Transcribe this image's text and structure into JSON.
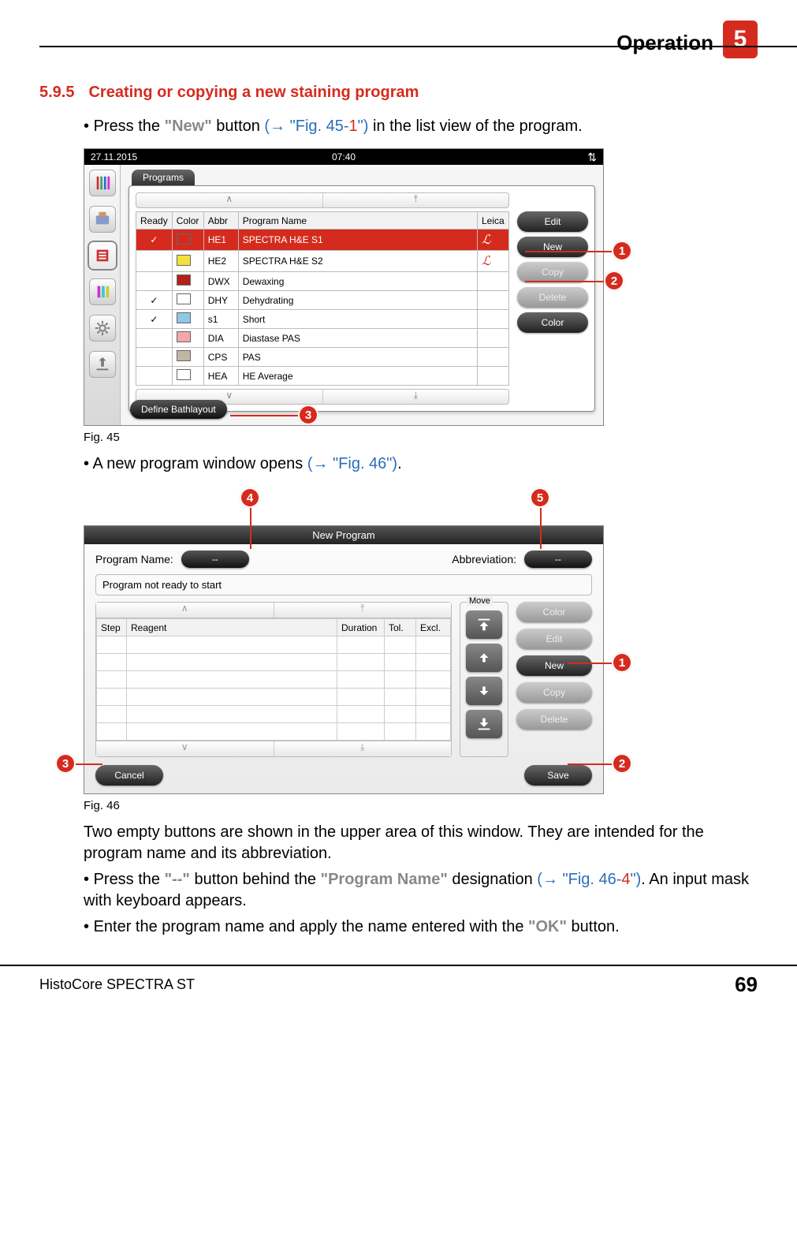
{
  "header": {
    "section": "Operation",
    "chapter": "5"
  },
  "section": {
    "number": "5.9.5",
    "title": "Creating or copying a new staining program"
  },
  "bullets": {
    "b1_pre": "Press the ",
    "b1_btn": "\"New\"",
    "b1_mid": " button ",
    "b1_link": "(→ \"Fig. 45-",
    "b1_link_red": "1",
    "b1_link_end": "\")",
    "b1_post": " in the list view of the program.",
    "b2_pre": "A new program window opens ",
    "b2_link": "(→ \"Fig. 46\")",
    "b2_post": ".",
    "para1": "Two empty buttons are shown in the upper area of this window. They are intended for the program name and its abbreviation.",
    "b3_pre": "Press the ",
    "b3_btn": "\"--\"",
    "b3_mid": " button behind the ",
    "b3_btn2": "\"Program Name\"",
    "b3_mid2": " designation ",
    "b3_link": "(→ \"Fig. 46-",
    "b3_link_red": "4",
    "b3_link_end": "\")",
    "b3_post": ". An input mask with keyboard appears.",
    "b4_pre": "Enter the program name and apply the name entered with the ",
    "b4_btn": "\"OK\"",
    "b4_post": " button."
  },
  "fig45": {
    "caption": "Fig. 45",
    "date": "27.11.2015",
    "time": "07:40",
    "tab": "Programs",
    "headers": {
      "ready": "Ready",
      "color": "Color",
      "abbr": "Abbr",
      "name": "Program Name",
      "leica": "Leica"
    },
    "rows": [
      {
        "ready": "✓",
        "color": "#d52b1e",
        "abbr": "HE1",
        "name": "SPECTRA H&E S1",
        "leica": true,
        "selected": true
      },
      {
        "ready": "",
        "color": "#f2e13a",
        "abbr": "HE2",
        "name": "SPECTRA H&E S2",
        "leica": true
      },
      {
        "ready": "",
        "color": "#b2221a",
        "abbr": "DWX",
        "name": "Dewaxing"
      },
      {
        "ready": "✓",
        "color": "#ffffff",
        "abbr": "DHY",
        "name": "Dehydrating"
      },
      {
        "ready": "✓",
        "color": "#8fc7e8",
        "abbr": "s1",
        "name": "Short"
      },
      {
        "ready": "",
        "color": "#f3a7a7",
        "abbr": "DIA",
        "name": "Diastase PAS"
      },
      {
        "ready": "",
        "color": "#bfb6a6",
        "abbr": "CPS",
        "name": "PAS"
      },
      {
        "ready": "",
        "color": "#ffffff",
        "abbr": "HEA",
        "name": "HE Average"
      }
    ],
    "buttons": {
      "edit": "Edit",
      "new": "New",
      "copy": "Copy",
      "delete": "Delete",
      "color": "Color",
      "define": "Define Bathlayout"
    },
    "callouts": {
      "c1": "1",
      "c2": "2",
      "c3": "3"
    }
  },
  "fig46": {
    "caption": "Fig. 46",
    "title": "New Program",
    "labels": {
      "progname": "Program Name:",
      "abbrev": "Abbreviation:",
      "dash": "--",
      "status": "Program not ready to start",
      "move": "Move"
    },
    "headers": {
      "step": "Step",
      "reagent": "Reagent",
      "duration": "Duration",
      "tol": "Tol.",
      "excl": "Excl."
    },
    "buttons": {
      "color": "Color",
      "edit": "Edit",
      "new": "New",
      "copy": "Copy",
      "delete": "Delete",
      "cancel": "Cancel",
      "save": "Save"
    },
    "callouts": {
      "c1": "1",
      "c2": "2",
      "c3": "3",
      "c4": "4",
      "c5": "5"
    }
  },
  "footer": {
    "product": "HistoCore SPECTRA ST",
    "page": "69"
  }
}
